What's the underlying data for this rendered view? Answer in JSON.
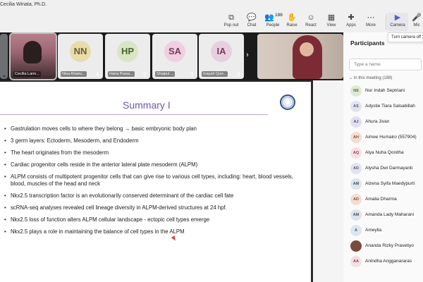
{
  "meeting": {
    "title": "Cecilia Winata, Ph.D."
  },
  "toolbar": {
    "buttons": [
      {
        "label": "Pop out",
        "icon": "pop-out-icon",
        "glyph": "⧉"
      },
      {
        "label": "Chat",
        "icon": "chat-icon",
        "glyph": "💬"
      },
      {
        "label": "People",
        "icon": "people-icon",
        "glyph": "👥",
        "count": "188"
      },
      {
        "label": "Raise",
        "icon": "raise-hand-icon",
        "glyph": "✋"
      },
      {
        "label": "React",
        "icon": "react-icon",
        "glyph": "☺"
      },
      {
        "label": "View",
        "icon": "view-icon",
        "glyph": "▦"
      },
      {
        "label": "Apps",
        "icon": "apps-icon",
        "glyph": "✚"
      },
      {
        "label": "More",
        "icon": "more-icon",
        "glyph": "⋯"
      },
      {
        "label": "Camera",
        "icon": "camera-icon",
        "glyph": "▶"
      },
      {
        "label": "Mic",
        "icon": "mic-icon",
        "glyph": "🎤"
      }
    ],
    "tooltip": "Turn camera off"
  },
  "strip": {
    "tiles": [
      {
        "kind": "video",
        "name": ""
      },
      {
        "kind": "video",
        "name": "Cecilia Lann..."
      },
      {
        "kind": "avatar",
        "initials": "NN",
        "name": "Nisa Khairu...",
        "color": "#e7dcaa"
      },
      {
        "kind": "avatar",
        "initials": "HP",
        "name": "Hana Prasa...",
        "color": "#d9e6c6"
      },
      {
        "kind": "avatar",
        "initials": "SA",
        "name": "Shaipul ...",
        "color": "#f0cfe0"
      },
      {
        "kind": "avatar",
        "initials": "IA",
        "name": "Inayah Qurr...",
        "color": "#e8cfe0"
      }
    ],
    "next": "›"
  },
  "panel": {
    "title": "Participants",
    "search_placeholder": "Type a name",
    "section_label": "In this meeting (188)",
    "participants": [
      {
        "initials": "NS",
        "name": "Nur Indah Septriani",
        "bg": "#dfe9d3",
        "fg": "#4c6b2e"
      },
      {
        "initials": "AS",
        "name": "Adystie Tiara Salsabillah",
        "bg": "#e3e3ef",
        "fg": "#55597a"
      },
      {
        "initials": "AJ",
        "name": "Ahura Jivan",
        "bg": "#e2e0f0",
        "fg": "#514a8a"
      },
      {
        "initials": "AH",
        "name": "Aimee Humairo (557904)",
        "bg": "#f4ddd3",
        "fg": "#8a4a32"
      },
      {
        "initials": "AQ",
        "name": "Alya Nuha Qonitha",
        "bg": "#f6dfe5",
        "fg": "#8d3f55"
      },
      {
        "initials": "AD",
        "name": "Alysha Dwi Darmayanti",
        "bg": "#e3e3ef",
        "fg": "#55597a"
      },
      {
        "initials": "AM",
        "name": "Alzena Syifa Maedypurti",
        "bg": "#dde4ea",
        "fg": "#3f5466"
      },
      {
        "initials": "AD",
        "name": "Amalia Dharma",
        "bg": "#f4ddd3",
        "fg": "#8a4a32"
      },
      {
        "initials": "AM",
        "name": "Amanda Lady Maharani",
        "bg": "#dde4ea",
        "fg": "#3f5466"
      },
      {
        "initials": "A",
        "name": "Ameylia",
        "bg": "#dce6ec",
        "fg": "#3d5a6d"
      },
      {
        "initials": "",
        "name": "Ananda Rizky Prasetiyo",
        "bg": "#7a4b3a",
        "fg": "#ffffff"
      },
      {
        "initials": "AA",
        "name": "Anindha Angganararas",
        "bg": "#f6dfe5",
        "fg": "#8d3f55"
      }
    ]
  },
  "slide": {
    "title": "Summary I",
    "bullets": [
      "Gastrulation moves cells to where they belong → basic embryonic body plan",
      "3 germ layers: Ectoderm, Mesoderm, and Endoderm",
      "The heart originates from the mesoderm",
      "Cardiac progenitor cells reside in the anterior lateral plate mesoderm (ALPM)",
      "ALPM consists of multipotent progenitor cells that can give rise to various cell types, including: heart, blood vessels, blood, muscles of the head and neck",
      "Nkx2.5 transcription factor is an evolutionarily conserved determinant of the cardiac cell fate",
      "scRNA-seq analyses revealed cell lineage diversity in ALPM-derived structures at 24 hpf.",
      "Nkx2.5 loss of function alters ALPM cellular landscape - ectopic cell types emerge",
      "Nkx2.5 plays a role in maintaining the balance of cell types in the ALPM"
    ]
  }
}
